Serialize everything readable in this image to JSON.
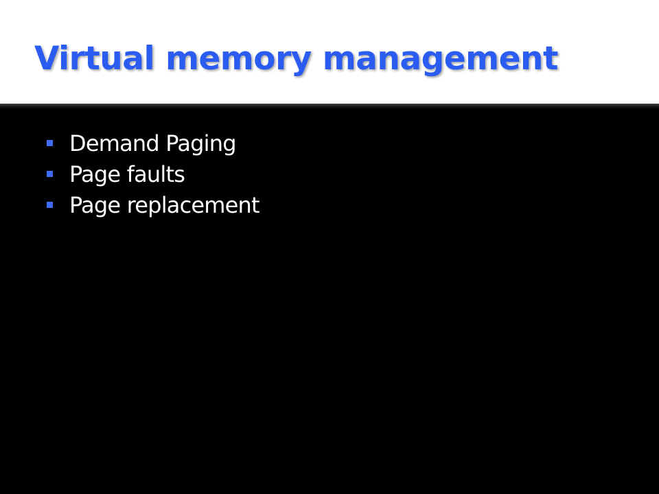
{
  "slide": {
    "title": "Virtual memory management",
    "bullets": [
      {
        "text": "Demand Paging"
      },
      {
        "text": "Page faults"
      },
      {
        "text": "Page replacement"
      }
    ]
  },
  "colors": {
    "title": "#2a5cf2",
    "bullet_marker": "#3f6cf2",
    "body_text": "#ffffff",
    "background": "#000000",
    "title_band": "#ffffff"
  },
  "icons": {
    "bullet": "square-bullet-icon"
  }
}
